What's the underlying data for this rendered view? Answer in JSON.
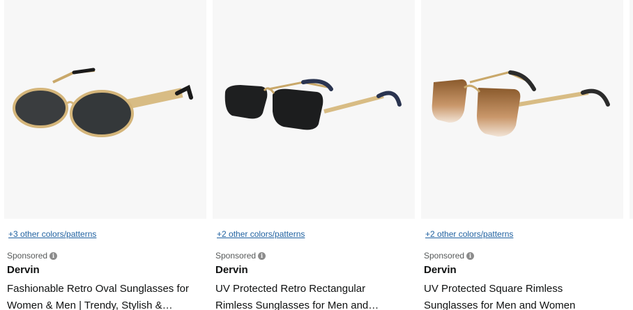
{
  "products": [
    {
      "colors_link": "+3 other colors/patterns",
      "sponsored": "Sponsored",
      "brand": "Dervin",
      "title_line1": "Fashionable Retro Oval Sunglasses for",
      "title_line2": "Women & Men | Trendy, Stylish &…",
      "image_icon": "oval-sunglasses-image"
    },
    {
      "colors_link": "+2 other colors/patterns",
      "sponsored": "Sponsored",
      "brand": "Dervin",
      "title_line1": "UV Protected Retro Rectangular",
      "title_line2": "Rimless Sunglasses for Men and…",
      "image_icon": "rectangular-rimless-sunglasses-image"
    },
    {
      "colors_link": "+2 other colors/patterns",
      "sponsored": "Sponsored",
      "brand": "Dervin",
      "title_line1": "UV Protected Square Rimless",
      "title_line2": "Sunglasses for Men and Women",
      "image_icon": "square-rimless-sunglasses-image"
    }
  ],
  "colors": {
    "link": "#2162a1",
    "image_background": "#f7f7f7",
    "text": "#0f1111",
    "sponsored_text": "#565959"
  }
}
